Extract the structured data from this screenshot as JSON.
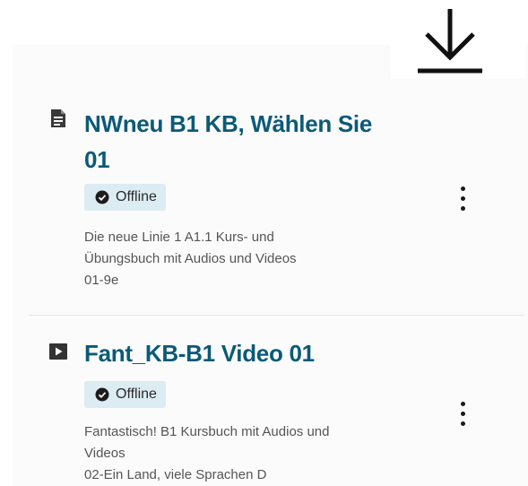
{
  "toolbar": {
    "download_icon": "download-icon"
  },
  "items": [
    {
      "type_icon": "document-icon",
      "title_line1": "NWneu B1 KB, Wählen Sie",
      "title_line2": "01",
      "status": "Offline",
      "status_icon": "check-circle-icon",
      "description": [
        "Die neue Linie 1 A1.1 Kurs- und",
        "Übungsbuch mit Audios und Videos",
        "01-9e"
      ],
      "menu_icon": "more-vertical-icon"
    },
    {
      "type_icon": "video-icon",
      "title_line1": "Fant_KB-B1 Video 01",
      "status": "Offline",
      "status_icon": "check-circle-icon",
      "description": [
        "Fantastisch! B1 Kursbuch mit Audios und",
        "Videos",
        "02-Ein Land, viele Sprachen D"
      ],
      "menu_icon": "more-vertical-icon"
    }
  ],
  "colors": {
    "title": "#0b5a78",
    "badge_background": "#dcecf3",
    "text_secondary": "#555555"
  }
}
